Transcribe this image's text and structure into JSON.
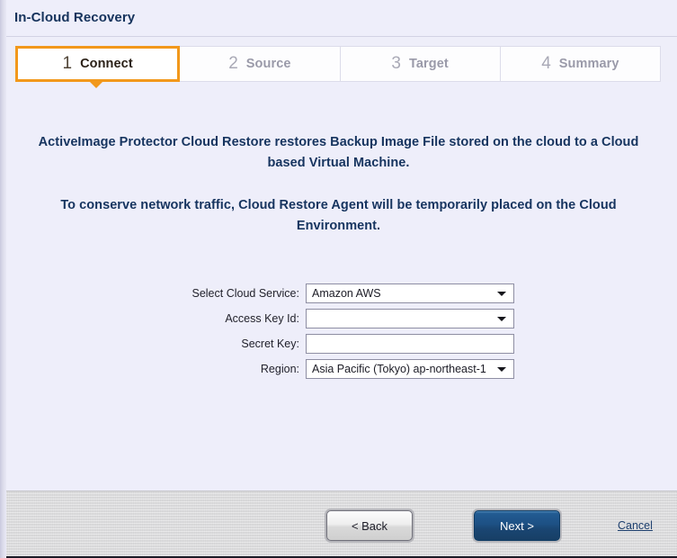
{
  "window": {
    "title": "In-Cloud Recovery"
  },
  "steps": [
    {
      "number": "1",
      "label": "Connect",
      "state": "active"
    },
    {
      "number": "2",
      "label": "Source",
      "state": "inactive"
    },
    {
      "number": "3",
      "label": "Target",
      "state": "inactive"
    },
    {
      "number": "4",
      "label": "Summary",
      "state": "inactive"
    }
  ],
  "intro": {
    "paragraph1": "ActiveImage Protector Cloud Restore restores Backup Image File stored on the cloud to a Cloud based Virtual Machine.",
    "paragraph2": "To conserve network traffic, Cloud Restore Agent will be temporarily placed on the Cloud Environment."
  },
  "form": {
    "cloud_service": {
      "label": "Select Cloud Service:",
      "value": "Amazon AWS",
      "type": "select"
    },
    "access_key": {
      "label": "Access Key Id:",
      "value": "",
      "type": "select"
    },
    "secret_key": {
      "label": "Secret Key:",
      "value": "",
      "placeholder": "",
      "type": "text"
    },
    "region": {
      "label": "Region:",
      "value": "Asia Pacific (Tokyo) ap-northeast-1",
      "type": "select"
    }
  },
  "footer": {
    "back_label": "< Back",
    "next_label": "Next >",
    "cancel_label": "Cancel"
  },
  "colors": {
    "accent_orange": "#f2981b",
    "heading_navy": "#16345f",
    "primary_button_blue": "#1d5084",
    "panel_background": "#eeeefa",
    "footer_background": "#dededf"
  }
}
